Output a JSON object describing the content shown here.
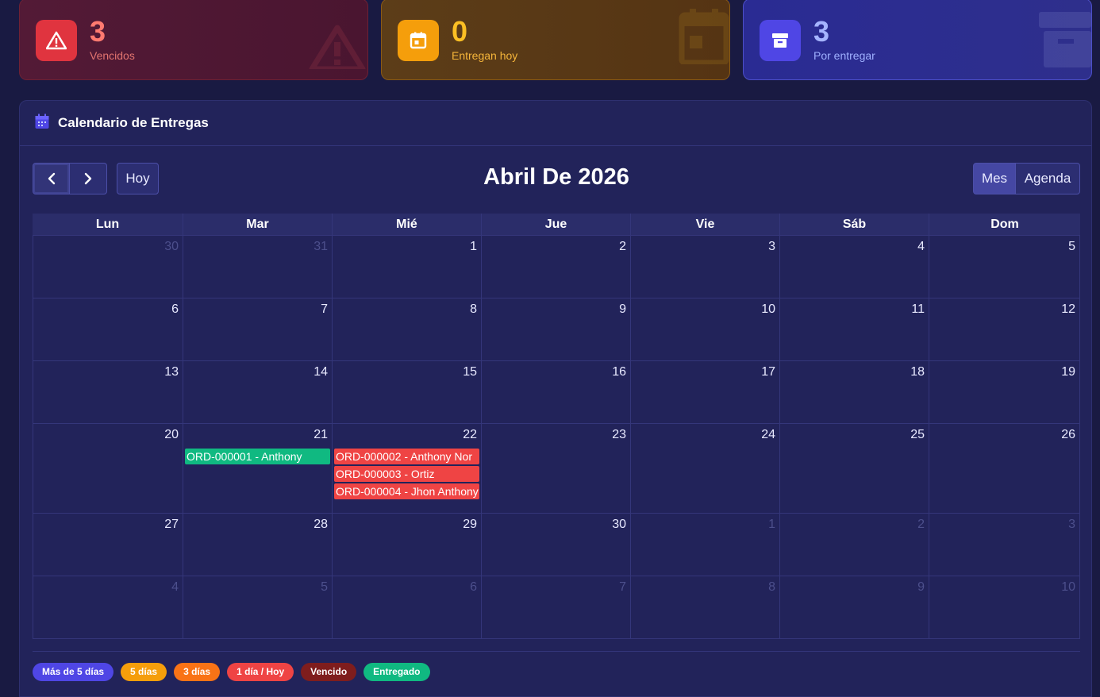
{
  "stats": [
    {
      "value": "3",
      "label": "Vencidos",
      "icon": "warning-icon"
    },
    {
      "value": "0",
      "label": "Entregan hoy",
      "icon": "calendar-icon"
    },
    {
      "value": "3",
      "label": "Por entregar",
      "icon": "archive-icon"
    }
  ],
  "panel": {
    "title": "Calendario de Entregas"
  },
  "toolbar": {
    "today_label": "Hoy",
    "month_title": "Abril De 2026",
    "view_month": "Mes",
    "view_agenda": "Agenda"
  },
  "weekdays": [
    "Lun",
    "Mar",
    "Mié",
    "Jue",
    "Vie",
    "Sáb",
    "Dom"
  ],
  "weeks": [
    [
      {
        "d": "30",
        "o": true
      },
      {
        "d": "31",
        "o": true
      },
      {
        "d": "1"
      },
      {
        "d": "2"
      },
      {
        "d": "3"
      },
      {
        "d": "4"
      },
      {
        "d": "5"
      }
    ],
    [
      {
        "d": "6"
      },
      {
        "d": "7"
      },
      {
        "d": "8"
      },
      {
        "d": "9"
      },
      {
        "d": "10"
      },
      {
        "d": "11"
      },
      {
        "d": "12"
      }
    ],
    [
      {
        "d": "13"
      },
      {
        "d": "14"
      },
      {
        "d": "15"
      },
      {
        "d": "16"
      },
      {
        "d": "17"
      },
      {
        "d": "18"
      },
      {
        "d": "19"
      }
    ],
    [
      {
        "d": "20"
      },
      {
        "d": "21",
        "events": [
          {
            "title": "ORD-000001 - Anthony",
            "status": "green"
          }
        ]
      },
      {
        "d": "22",
        "events": [
          {
            "title": "ORD-000002 - Anthony Nor",
            "status": "red"
          },
          {
            "title": "ORD-000003 - Ortiz",
            "status": "red"
          },
          {
            "title": "ORD-000004 - Jhon Anthony",
            "status": "red"
          }
        ]
      },
      {
        "d": "23"
      },
      {
        "d": "24"
      },
      {
        "d": "25"
      },
      {
        "d": "26"
      }
    ],
    [
      {
        "d": "27"
      },
      {
        "d": "28"
      },
      {
        "d": "29"
      },
      {
        "d": "30"
      },
      {
        "d": "1",
        "o": true
      },
      {
        "d": "2",
        "o": true
      },
      {
        "d": "3",
        "o": true
      }
    ],
    [
      {
        "d": "4",
        "o": true
      },
      {
        "d": "5",
        "o": true
      },
      {
        "d": "6",
        "o": true
      },
      {
        "d": "7",
        "o": true
      },
      {
        "d": "8",
        "o": true
      },
      {
        "d": "9",
        "o": true
      },
      {
        "d": "10",
        "o": true
      }
    ]
  ],
  "legend": [
    {
      "label": "Más de 5 días",
      "color": "#4f46e5"
    },
    {
      "label": "5 días",
      "color": "#f59e0b"
    },
    {
      "label": "3 días",
      "color": "#f97316"
    },
    {
      "label": "1 día / Hoy",
      "color": "#ef4444"
    },
    {
      "label": "Vencido",
      "color": "#7f1d1d"
    },
    {
      "label": "Entregado",
      "color": "#10b981"
    }
  ]
}
